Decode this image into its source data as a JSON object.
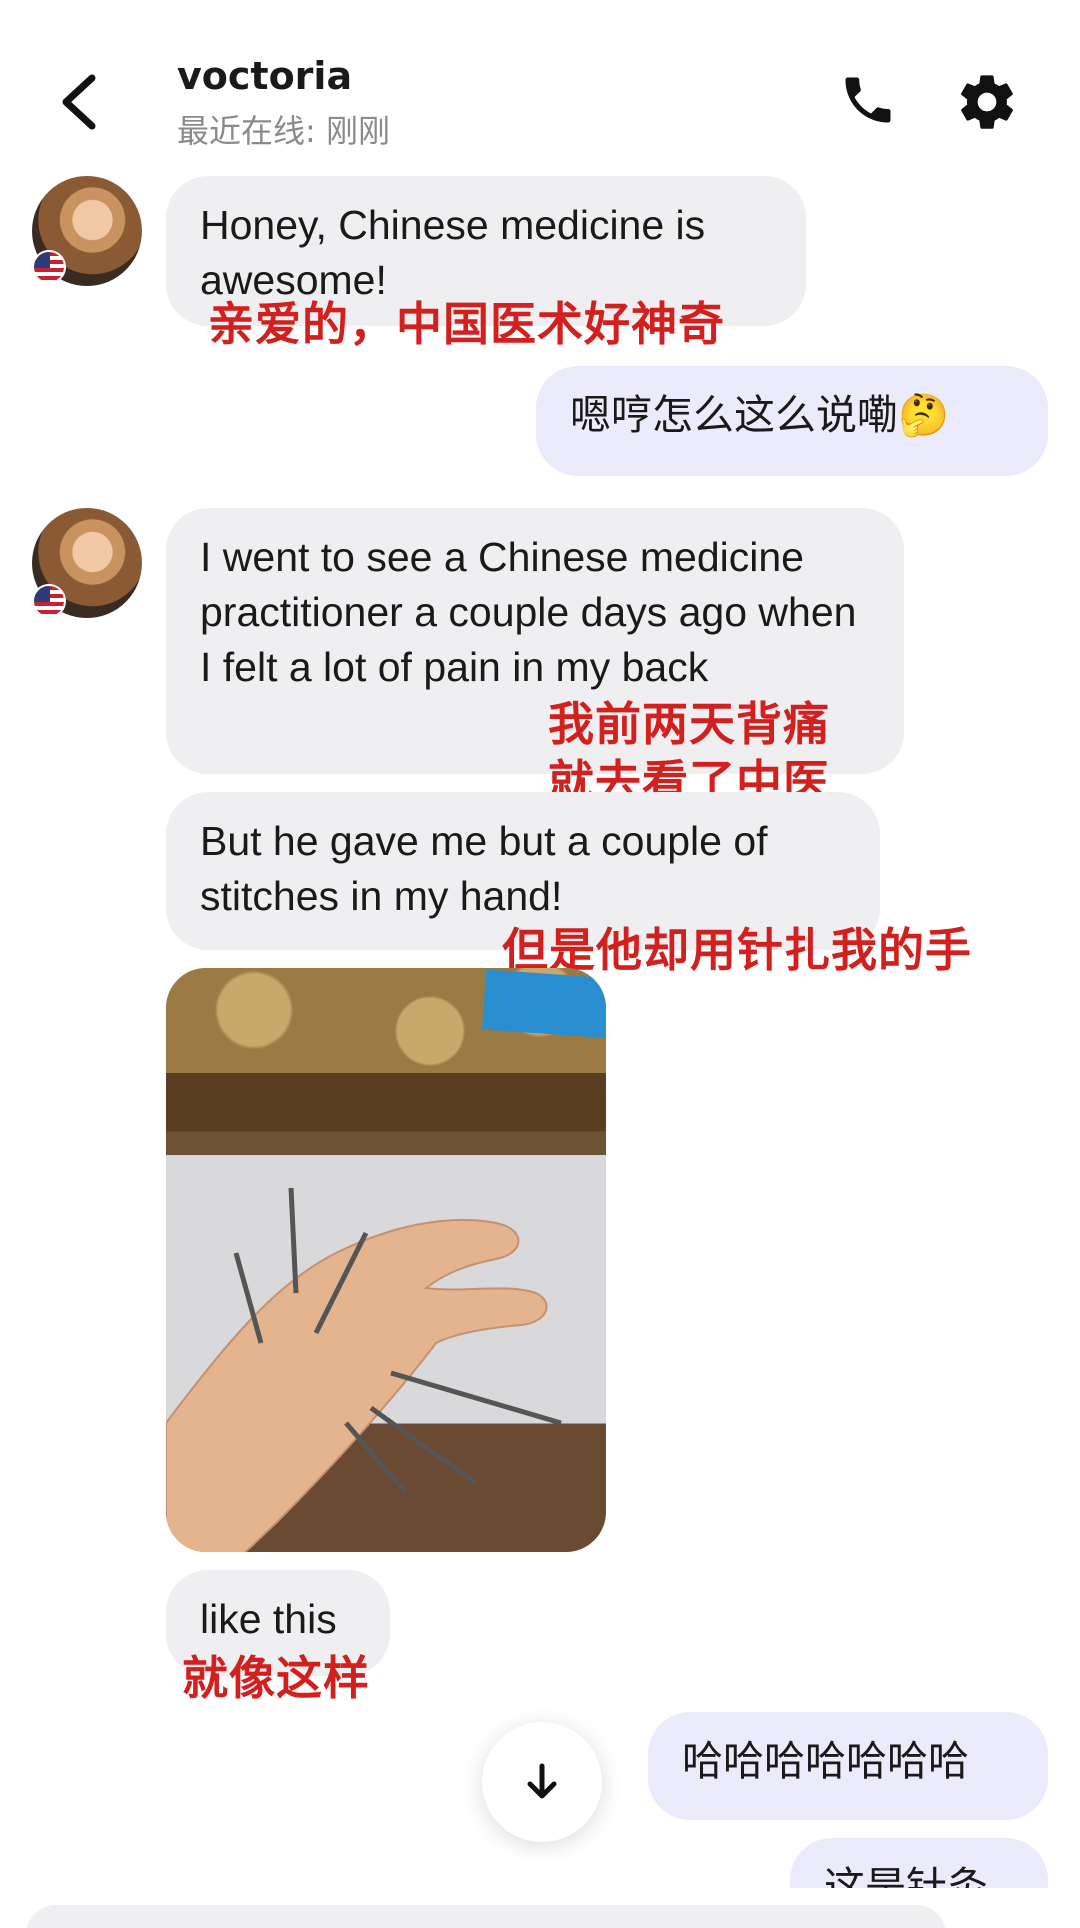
{
  "header": {
    "name": "voctoria",
    "status": "最近在线: 刚刚"
  },
  "messages": {
    "m1": {
      "text": "Honey, Chinese medicine is awesome!",
      "caption": "亲爱的，中国医术好神奇"
    },
    "m2": {
      "text": "嗯哼怎么这么说嘞🤔"
    },
    "m3": {
      "text": "I went to see a Chinese medicine practitioner a couple days ago when I felt a lot of pain in my back",
      "caption_line1": "我前两天背痛",
      "caption_line2": "就去看了中医"
    },
    "m4": {
      "text": "But he gave me but a couple of stitches in my hand!",
      "caption": "但是他却用针扎我的手"
    },
    "m5": {
      "text": "like this",
      "caption": "就像这样"
    },
    "m6": {
      "text": "哈哈哈哈哈哈哈"
    },
    "m7": {
      "text": "这是针灸"
    }
  },
  "colors": {
    "incoming_bubble": "#efeff1",
    "outgoing_bubble": "#ecebfb",
    "caption_red": "#d2201f"
  },
  "icons": {
    "back": "chevron-left-icon",
    "call": "phone-icon",
    "settings": "gear-icon",
    "scroll": "arrow-down-icon"
  }
}
